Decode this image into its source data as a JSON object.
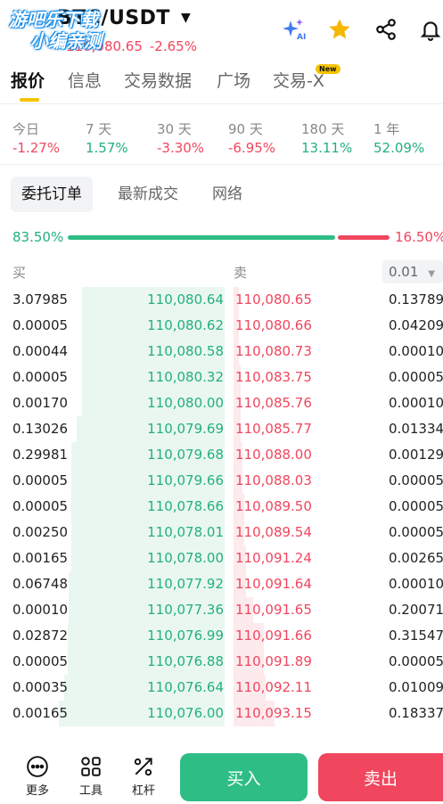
{
  "header": {
    "pair": "BTC/USDT",
    "price": "110,080.65",
    "change": "-2.65%",
    "watermark_line1": "游吧乐下载",
    "watermark_line2": "小编亲测",
    "ai_label": "AI"
  },
  "tabs": [
    "报价",
    "信息",
    "交易数据",
    "广场",
    "交易-X"
  ],
  "new_badge": "New",
  "performance": [
    {
      "label": "今日",
      "value": "-1.27%",
      "trend": "neg"
    },
    {
      "label": "7 天",
      "value": "1.57%",
      "trend": "pos"
    },
    {
      "label": "30 天",
      "value": "-3.30%",
      "trend": "neg"
    },
    {
      "label": "90 天",
      "value": "-6.95%",
      "trend": "neg"
    },
    {
      "label": "180 天",
      "value": "13.11%",
      "trend": "pos"
    },
    {
      "label": "1 年",
      "value": "52.09%",
      "trend": "pos"
    }
  ],
  "subtabs": [
    "委托订单",
    "最新成交",
    "网络"
  ],
  "ratio": {
    "buy": "83.50%",
    "sell": "16.50%",
    "buy_fraction": 0.835
  },
  "book_headers": {
    "buy": "买",
    "sell": "卖",
    "precision": "0.01"
  },
  "orderbook": [
    {
      "bq": "3.07985",
      "bp": "110,080.64",
      "ap": "110,080.65",
      "aq": "0.13789"
    },
    {
      "bq": "0.00005",
      "bp": "110,080.62",
      "ap": "110,080.66",
      "aq": "0.04209"
    },
    {
      "bq": "0.00044",
      "bp": "110,080.58",
      "ap": "110,080.73",
      "aq": "0.00010"
    },
    {
      "bq": "0.00005",
      "bp": "110,080.32",
      "ap": "110,083.75",
      "aq": "0.00005"
    },
    {
      "bq": "0.00170",
      "bp": "110,080.00",
      "ap": "110,085.76",
      "aq": "0.00010"
    },
    {
      "bq": "0.13026",
      "bp": "110,079.69",
      "ap": "110,085.77",
      "aq": "0.01334"
    },
    {
      "bq": "0.29981",
      "bp": "110,079.68",
      "ap": "110,088.00",
      "aq": "0.00129"
    },
    {
      "bq": "0.00005",
      "bp": "110,079.66",
      "ap": "110,088.03",
      "aq": "0.00005"
    },
    {
      "bq": "0.00005",
      "bp": "110,078.66",
      "ap": "110,089.50",
      "aq": "0.00005"
    },
    {
      "bq": "0.00250",
      "bp": "110,078.01",
      "ap": "110,089.54",
      "aq": "0.00005"
    },
    {
      "bq": "0.00165",
      "bp": "110,078.00",
      "ap": "110,091.24",
      "aq": "0.00265"
    },
    {
      "bq": "0.06748",
      "bp": "110,077.92",
      "ap": "110,091.64",
      "aq": "0.00010"
    },
    {
      "bq": "0.00010",
      "bp": "110,077.36",
      "ap": "110,091.65",
      "aq": "0.20071"
    },
    {
      "bq": "0.02872",
      "bp": "110,076.99",
      "ap": "110,091.66",
      "aq": "0.31547"
    },
    {
      "bq": "0.00005",
      "bp": "110,076.88",
      "ap": "110,091.89",
      "aq": "0.00005"
    },
    {
      "bq": "0.00035",
      "bp": "110,076.64",
      "ap": "110,092.11",
      "aq": "0.01009"
    },
    {
      "bq": "0.00165",
      "bp": "110,076.00",
      "ap": "110,093.15",
      "aq": "0.18337"
    }
  ],
  "bottom": {
    "tools": [
      "更多",
      "工具",
      "杠杆"
    ],
    "buy": "买入",
    "sell": "卖出"
  },
  "colors": {
    "up": "#23b07d",
    "down": "#f0465e",
    "accent": "#f5c400"
  },
  "icons": [
    "back-chevron-icon",
    "ai-sparkle-icon",
    "star-icon",
    "share-icon",
    "bell-icon",
    "more-dots-icon",
    "tools-grid-icon",
    "leverage-icon"
  ]
}
